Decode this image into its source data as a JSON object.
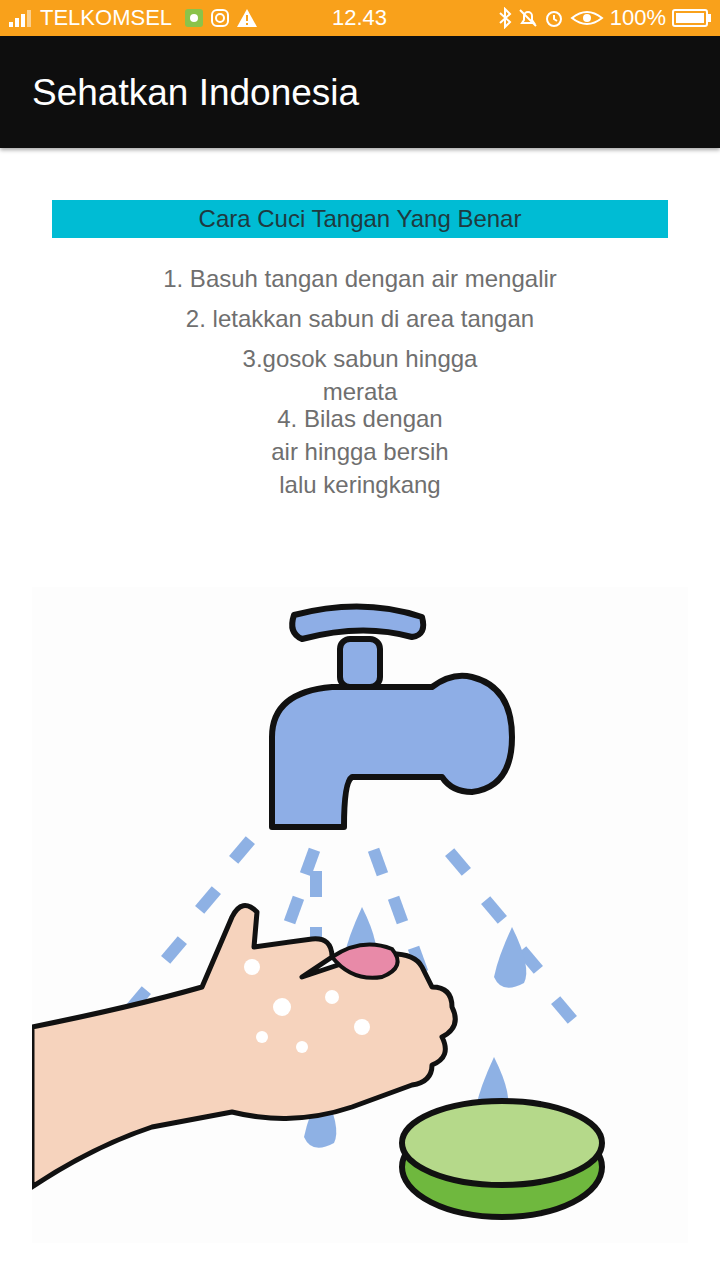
{
  "status_bar": {
    "carrier": "TELKOMSEL",
    "time": "12.43",
    "battery": "100%"
  },
  "app_bar": {
    "title": "Sehatkan Indonesia"
  },
  "banner": {
    "title": "Cara Cuci Tangan Yang Benar"
  },
  "steps": [
    "1. Basuh tangan dengan air mengalir",
    "2. letakkan sabun di area tangan",
    "3.gosok sabun hingga\nmerata",
    "4. Bilas dengan\nair hingga bersih\nlalu keringkang"
  ]
}
